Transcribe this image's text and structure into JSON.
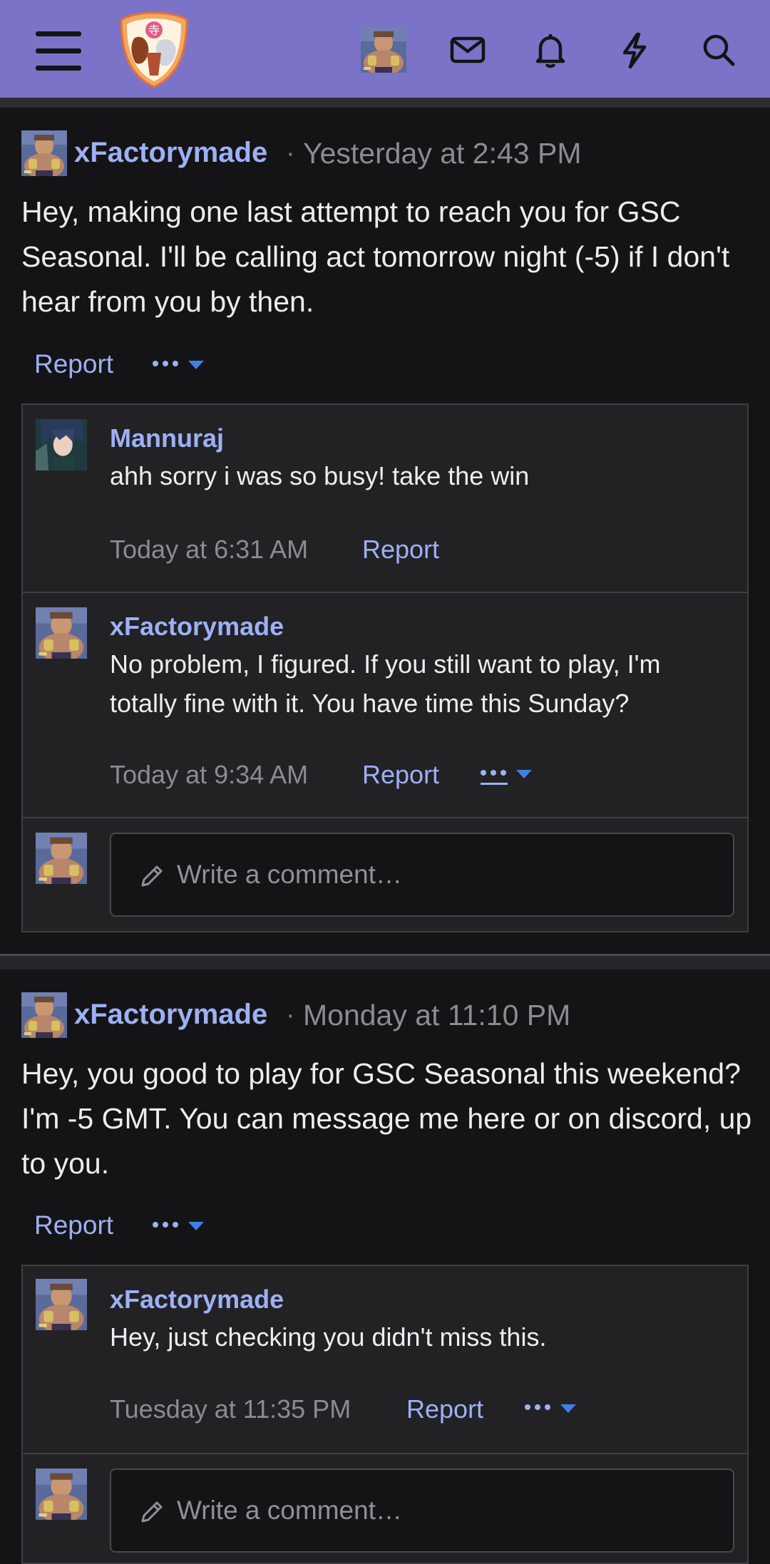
{
  "header": {
    "icons": [
      "menu-icon",
      "site-logo",
      "user-avatar",
      "mail-icon",
      "bell-icon",
      "bolt-icon",
      "search-icon"
    ]
  },
  "posts": [
    {
      "author": "xFactorymade",
      "separator": "·",
      "time": "Yesterday at 2:43 PM",
      "body": "Hey, making one last attempt to reach you for GSC Seasonal. I'll be calling act tomorrow night (-5) if I don't hear from you by then.",
      "report": "Report",
      "comments": [
        {
          "author": "Mannuraj",
          "text": "ahh sorry i was so busy! take the win",
          "time": "Today at 6:31 AM",
          "report": "Report"
        },
        {
          "author": "xFactorymade",
          "text": "No problem, I figured. If you still want to play, I'm totally fine with it. You have time this Sunday?",
          "time": "Today at 9:34 AM",
          "report": "Report"
        }
      ],
      "comment_placeholder": "Write a comment…"
    },
    {
      "author": "xFactorymade",
      "separator": "·",
      "time": "Monday at 11:10 PM",
      "body": "Hey, you good to play for GSC Seasonal this weekend? I'm -5 GMT. You can message me here or on discord, up to you.",
      "report": "Report",
      "comments": [
        {
          "author": "xFactorymade",
          "text": "Hey, just checking you didn't miss this.",
          "time": "Tuesday at 11:35 PM",
          "report": "Report"
        }
      ],
      "comment_placeholder": "Write a comment…"
    }
  ],
  "colors": {
    "header": "#7b73c7",
    "link": "#9eb0f4",
    "caret": "#3f7fe8",
    "background": "#141416",
    "comment_bg": "#222225"
  }
}
